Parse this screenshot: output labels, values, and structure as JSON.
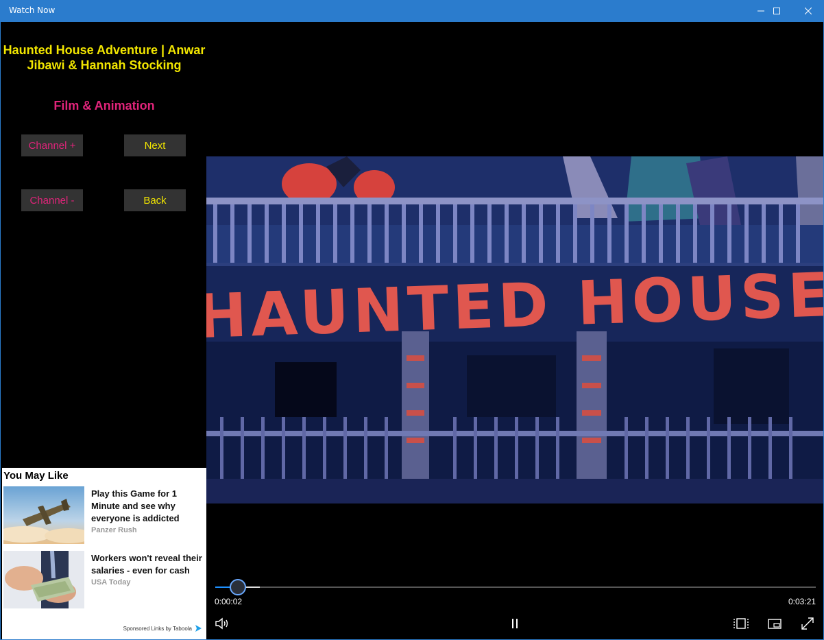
{
  "window": {
    "title": "Watch Now",
    "accent": "#2b7ccd"
  },
  "video": {
    "title": "Haunted House Adventure | Anwar Jibawi & Hannah Stocking",
    "category": "Film & Animation",
    "title_color": "#f2e600",
    "category_color": "#e0247a"
  },
  "nav": {
    "channel_plus": "Channel +",
    "next": "Next",
    "channel_minus": "Channel -",
    "back": "Back"
  },
  "ads": {
    "heading": "You May Like",
    "items": [
      {
        "title": "Play this Game for 1 Minute and see why everyone is addicted",
        "source": "Panzer Rush",
        "thumb_icon": "airplane-thumbnail"
      },
      {
        "title": "Workers won't reveal their salaries - even for cash",
        "source": "USA Today",
        "thumb_icon": "cash-hand-thumbnail"
      }
    ],
    "sponsored": "Sponsored Links by Taboola"
  },
  "player": {
    "current_time": "0:00:02",
    "duration": "0:03:21",
    "progress_fraction": 0.01,
    "buffer_fraction": 0.074,
    "frame_text": "HAUNTED HOUSE",
    "controls": [
      "volume-icon",
      "pause-icon",
      "aspect-ratio-icon",
      "cast-icon",
      "fullscreen-icon"
    ]
  }
}
